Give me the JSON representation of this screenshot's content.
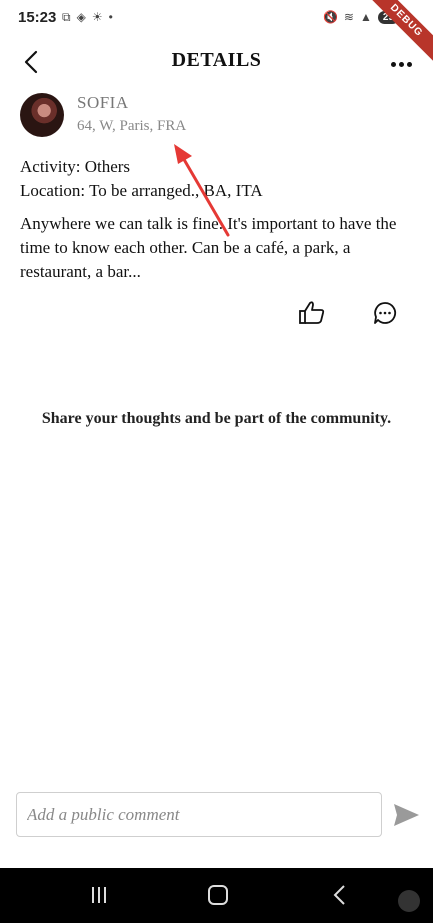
{
  "status_bar": {
    "time": "15:23",
    "left_icons": [
      "screenshot-icon",
      "app-icon",
      "brightness-icon",
      "dot-icon"
    ],
    "right_icons": [
      "mute-icon",
      "wifi-icon",
      "signal-icon"
    ],
    "battery": "29",
    "debug_label": "DEBUG"
  },
  "header": {
    "title": "DETAILS",
    "back_icon": "chevron-left-icon",
    "more_icon": "more-horizontal-icon"
  },
  "author": {
    "name": "SOFIA",
    "meta": "64, W, Paris, FRA"
  },
  "post": {
    "activity": "Activity: Others",
    "location": "Location: To be arranged., BA, ITA",
    "description": "Anywhere we can talk is fine. It's important to have the time to know each other. Can be a café, a park, a restaurant, a bar..."
  },
  "actions": {
    "like_icon": "thumbs-up-icon",
    "comment_icon": "comment-icon"
  },
  "community_prompt": "Share your thoughts and be part of the community.",
  "comment_box": {
    "placeholder": "Add a public comment",
    "value": "",
    "send_icon": "send-icon"
  },
  "nav_bar": {
    "icons": [
      "recents-icon",
      "home-icon",
      "back-icon",
      "accessibility-icon"
    ]
  },
  "colors": {
    "annotation_arrow": "#e53935",
    "debug_ribbon": "#b8352a"
  }
}
